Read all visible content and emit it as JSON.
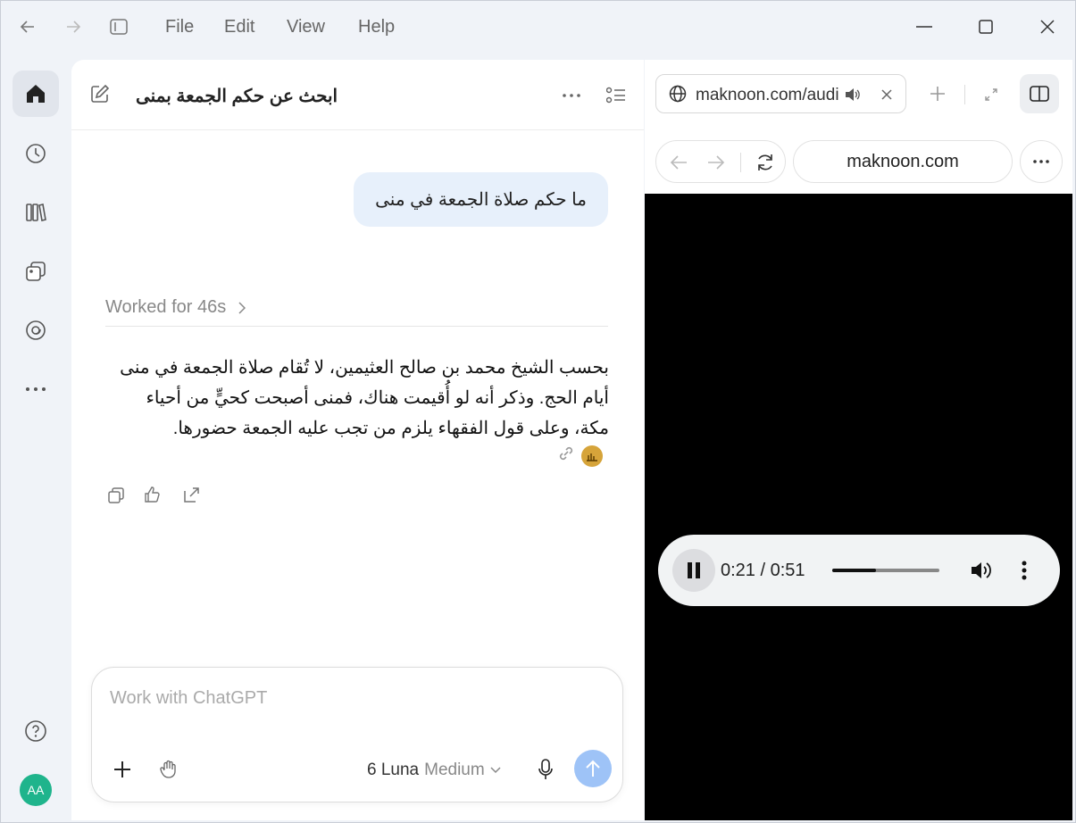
{
  "menu": [
    "File",
    "Edit",
    "View",
    "Help"
  ],
  "chat": {
    "title": "ابحث عن حكم الجمعة بمنى",
    "user_message": "ما حكم صلاة الجمعة في منى",
    "worked_label": "Worked for 46s",
    "answer": "بحسب الشيخ محمد بن صالح العثيمين، لا تُقام صلاة الجمعة في منى أيام الحج. وذكر أنه لو أُقيمت هناك، فمنى أصبحت كحيٍّ من أحياء مكة، وعلى قول الفقهاء يلزم من تجب عليه الجمعة حضورها.",
    "composer": {
      "placeholder": "Work with ChatGPT",
      "model_name": "6 Luna",
      "model_tier": "Medium"
    }
  },
  "user": {
    "initials": "AA"
  },
  "browser": {
    "tab_title": "maknoon.com/audio",
    "url": "maknoon.com",
    "player": {
      "time": "0:21 / 0:51",
      "progress": 0.41
    }
  },
  "colors": {
    "avatar": "#1fb48c",
    "user_bubble": "#e7f0fb",
    "send_button": "#9ec3f7"
  }
}
